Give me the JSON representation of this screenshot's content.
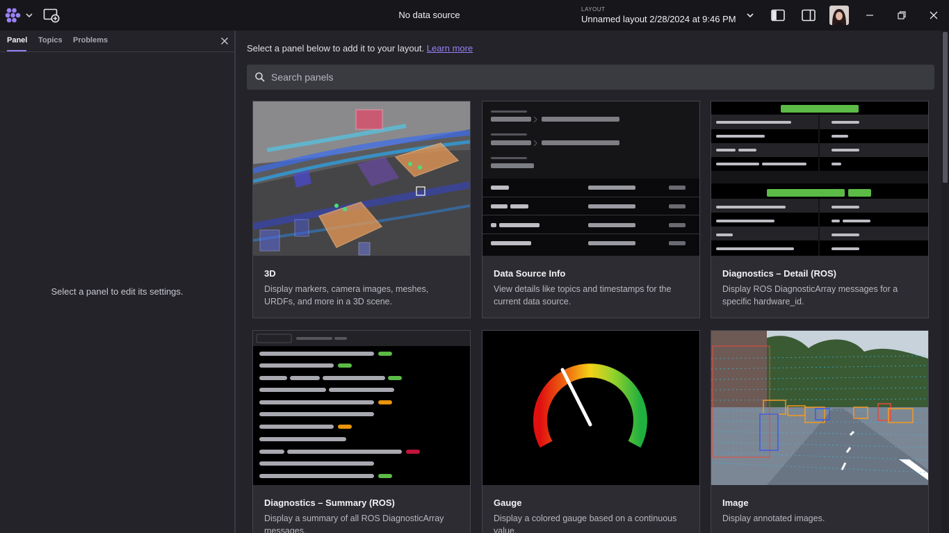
{
  "titlebar": {
    "data_source": "No data source",
    "layout_caption": "LAYOUT",
    "layout_name": "Unnamed layout 2/28/2024 at 9:46 PM"
  },
  "sidebar": {
    "tabs": [
      {
        "label": "Panel",
        "active": true
      },
      {
        "label": "Topics",
        "active": false
      },
      {
        "label": "Problems",
        "active": false
      }
    ],
    "empty_message": "Select a panel to edit its settings."
  },
  "main": {
    "intro_text": "Select a panel below to add it to your layout.",
    "learn_more": "Learn more",
    "search_placeholder": "Search panels"
  },
  "panels": [
    {
      "title": "3D",
      "description": "Display markers, camera images, meshes, URDFs, and more in a 3D scene."
    },
    {
      "title": "Data Source Info",
      "description": "View details like topics and timestamps for the current data source."
    },
    {
      "title": "Diagnostics – Detail (ROS)",
      "description": "Display ROS DiagnosticArray messages for a specific hardware_id."
    },
    {
      "title": "Diagnostics – Summary (ROS)",
      "description": "Display a summary of all ROS DiagnosticArray messages."
    },
    {
      "title": "Gauge",
      "description": "Display a colored gauge based on a continuous value."
    },
    {
      "title": "Image",
      "description": "Display annotated images."
    }
  ],
  "colors": {
    "accent": "#9a80f5",
    "ok_green": "#5cbb46",
    "warn_orange": "#e8940c",
    "error_red": "#c0143c"
  },
  "icons": [
    "foxglove-logo-icon",
    "chevron-down-icon",
    "add-panel-icon",
    "left-sidebar-icon",
    "right-sidebar-icon",
    "minimize-icon",
    "restore-icon",
    "close-icon",
    "search-icon"
  ]
}
